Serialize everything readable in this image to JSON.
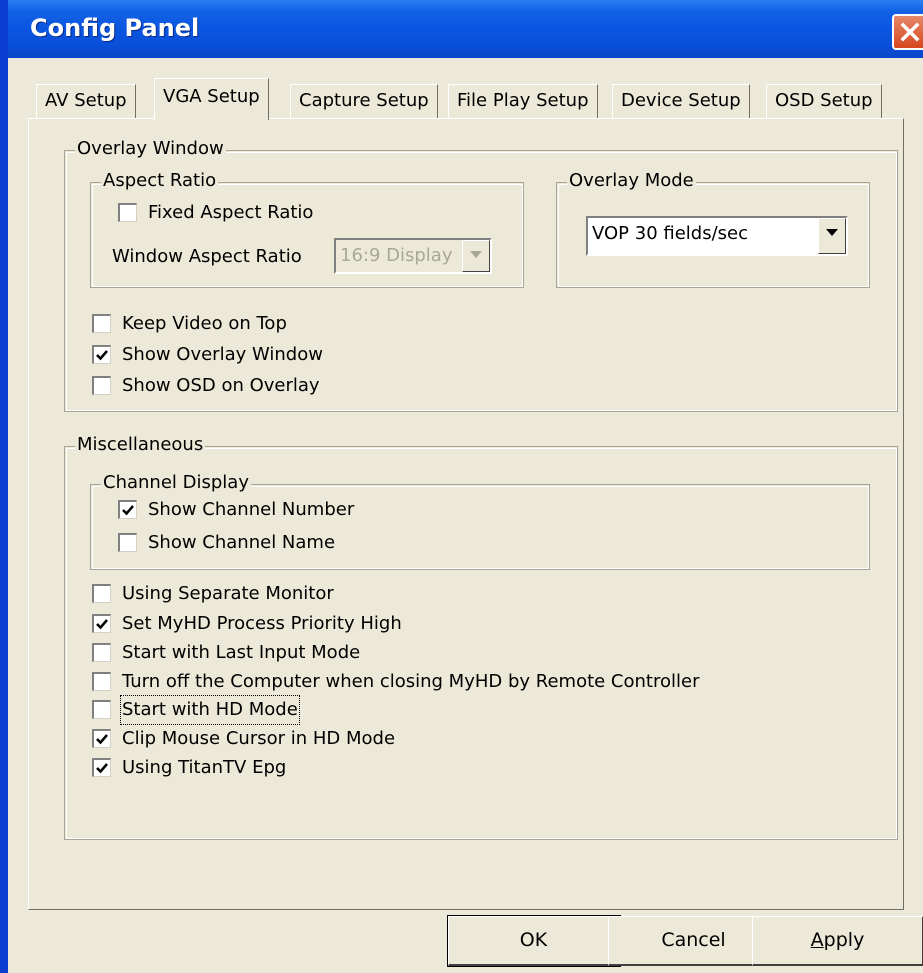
{
  "window": {
    "title": "Config Panel"
  },
  "tabs": [
    {
      "label": "AV Setup"
    },
    {
      "label": "VGA Setup"
    },
    {
      "label": "Capture Setup"
    },
    {
      "label": "File Play Setup"
    },
    {
      "label": "Device Setup"
    },
    {
      "label": "OSD Setup"
    }
  ],
  "active_tab": "VGA Setup",
  "overlay_window": {
    "legend": "Overlay Window",
    "aspect_ratio": {
      "legend": "Aspect Ratio",
      "fixed_aspect_ratio": {
        "label": "Fixed Aspect Ratio",
        "checked": false
      },
      "window_aspect_ratio_label": "Window Aspect Ratio",
      "window_aspect_ratio_value": "16:9 Display"
    },
    "overlay_mode": {
      "legend": "Overlay Mode",
      "value": "VOP 30 fields/sec"
    },
    "options": [
      {
        "label": "Keep Video on Top",
        "checked": false
      },
      {
        "label": "Show Overlay Window",
        "checked": true
      },
      {
        "label": "Show OSD on Overlay",
        "checked": false
      }
    ]
  },
  "miscellaneous": {
    "legend": "Miscellaneous",
    "channel_display": {
      "legend": "Channel Display",
      "options": [
        {
          "label": "Show Channel Number",
          "checked": true
        },
        {
          "label": "Show Channel Name",
          "checked": false
        }
      ]
    },
    "options": [
      {
        "label": "Using Separate Monitor",
        "checked": false
      },
      {
        "label": "Set MyHD Process Priority High",
        "checked": true
      },
      {
        "label": "Start with Last Input Mode",
        "checked": false
      },
      {
        "label": "Turn off the Computer when closing MyHD by Remote Controller",
        "checked": false
      },
      {
        "label": "Start with HD Mode",
        "checked": false
      },
      {
        "label": "Clip Mouse Cursor in HD Mode",
        "checked": true
      },
      {
        "label": "Using TitanTV Epg",
        "checked": true
      }
    ]
  },
  "buttons": {
    "ok": "OK",
    "cancel": "Cancel",
    "apply_mnemonic": "A",
    "apply_rest": "pply"
  },
  "colors": {
    "titlebar": "#0a55e0",
    "dialog_bg": "#ece9d8",
    "close_button": "#d6471c"
  }
}
